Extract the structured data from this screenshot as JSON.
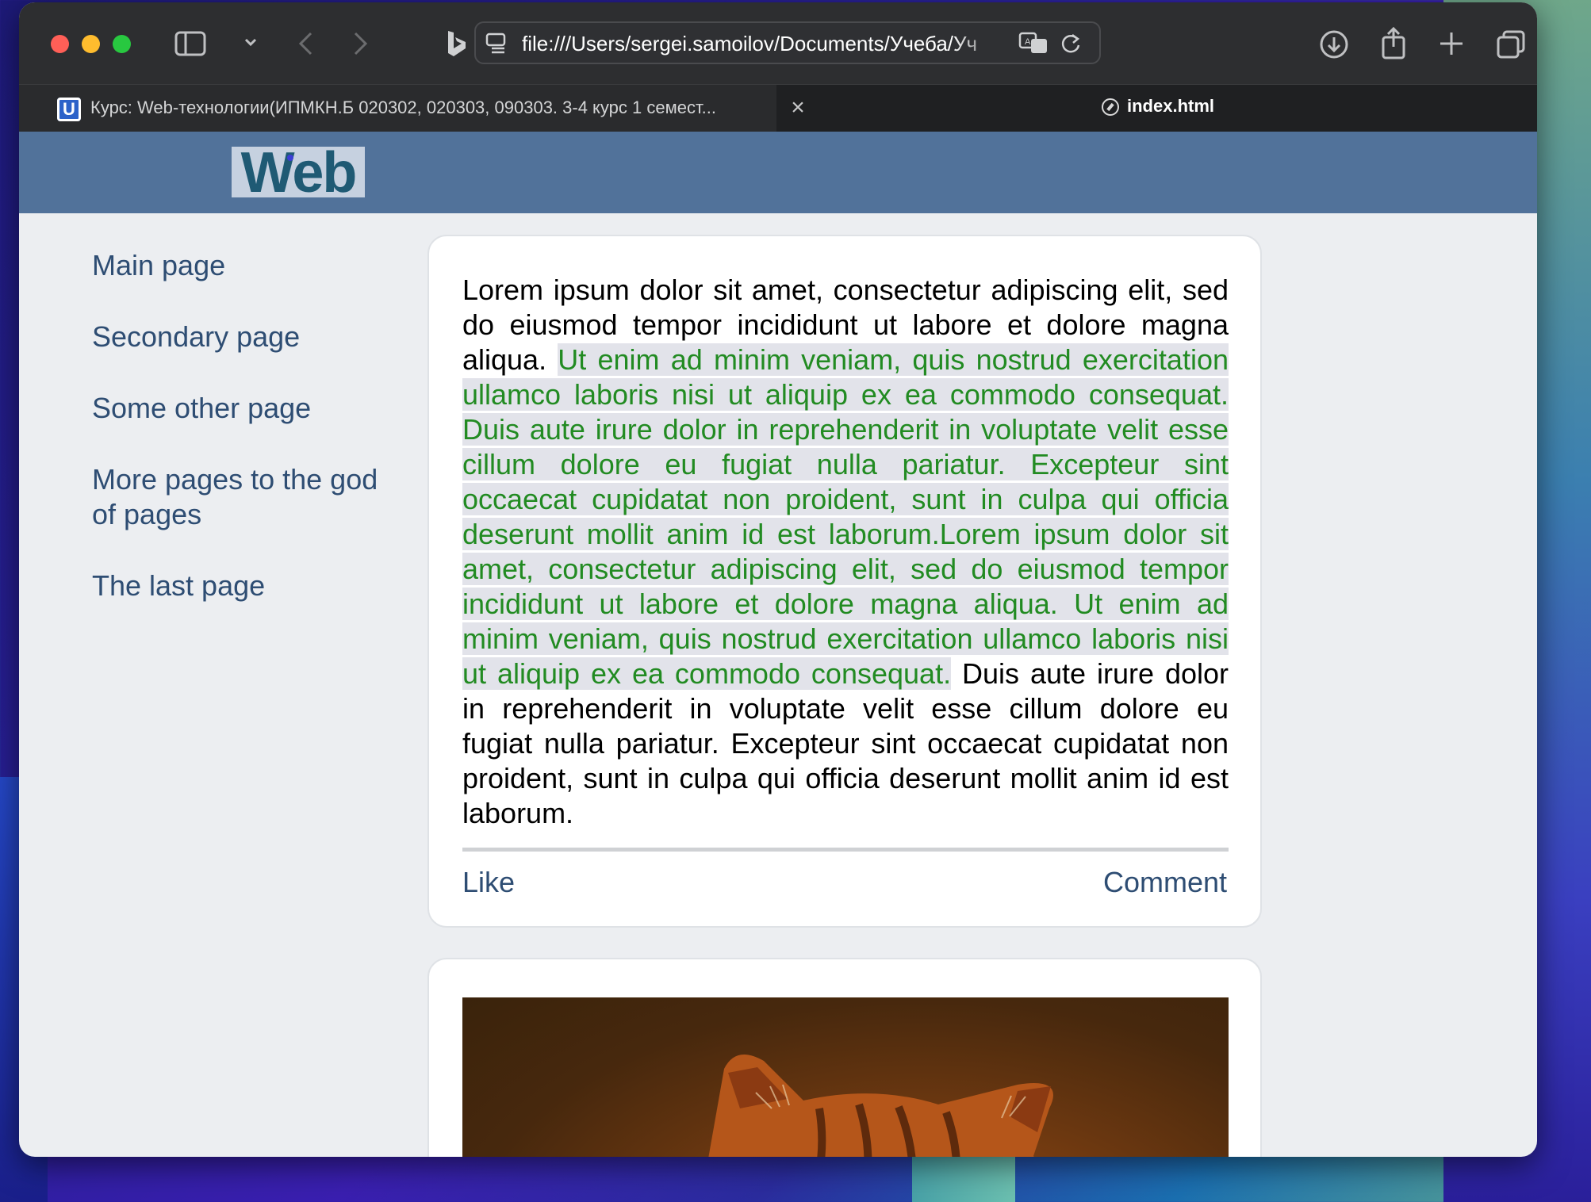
{
  "browser": {
    "url": "file:///Users/sergei.samoilov/Documents/Учеба/Уч",
    "tabs": [
      {
        "title": "Курс: Web-технологии(ИПМКН.Б 020302, 020303, 090303. 3-4 курс 1 семест...",
        "favicon": "university-favicon"
      },
      {
        "title": "index.html",
        "favicon": "compass-icon"
      }
    ],
    "close_glyph": "×"
  },
  "site": {
    "logo_text": "Web",
    "nav": [
      {
        "label": "Main page"
      },
      {
        "label": "Secondary page"
      },
      {
        "label": "Some other page"
      },
      {
        "label": "More pages to the god of pages"
      },
      {
        "label": "The last page"
      }
    ]
  },
  "post": {
    "text_before": "Lorem ipsum dolor sit amet, consectetur adipiscing elit, sed do eiusmod tempor incididunt ut labore et dolore magna aliqua. ",
    "text_selected": "Ut enim ad minim veniam, quis nostrud exercitation ullamco laboris nisi ut aliquip ex ea commodo consequat. Duis aute irure dolor in reprehenderit in voluptate velit esse cillum dolore eu fugiat nulla pariatur. Excepteur sint occaecat cupidatat non proident, sunt in culpa qui officia deserunt mollit anim id est laborum.Lorem ipsum dolor sit amet, consectetur adipiscing elit, sed do eiusmod tempor incididunt ut labore et dolore magna aliqua. Ut enim ad minim veniam, quis nostrud exercitation ullamco laboris nisi ut aliquip ex ea commodo consequat.",
    "text_after": " Duis aute irure dolor in reprehenderit in voluptate velit esse cillum dolore eu fugiat nulla pariatur. Excepteur sint occaecat cupidatat non proident, sunt in culpa qui officia deserunt mollit anim id est laborum.",
    "like_label": "Like",
    "comment_label": "Comment"
  },
  "colors": {
    "header_bg": "#51729a",
    "link": "#2e4d73",
    "highlight_text": "#228b22",
    "page_bg": "#eceef1"
  }
}
